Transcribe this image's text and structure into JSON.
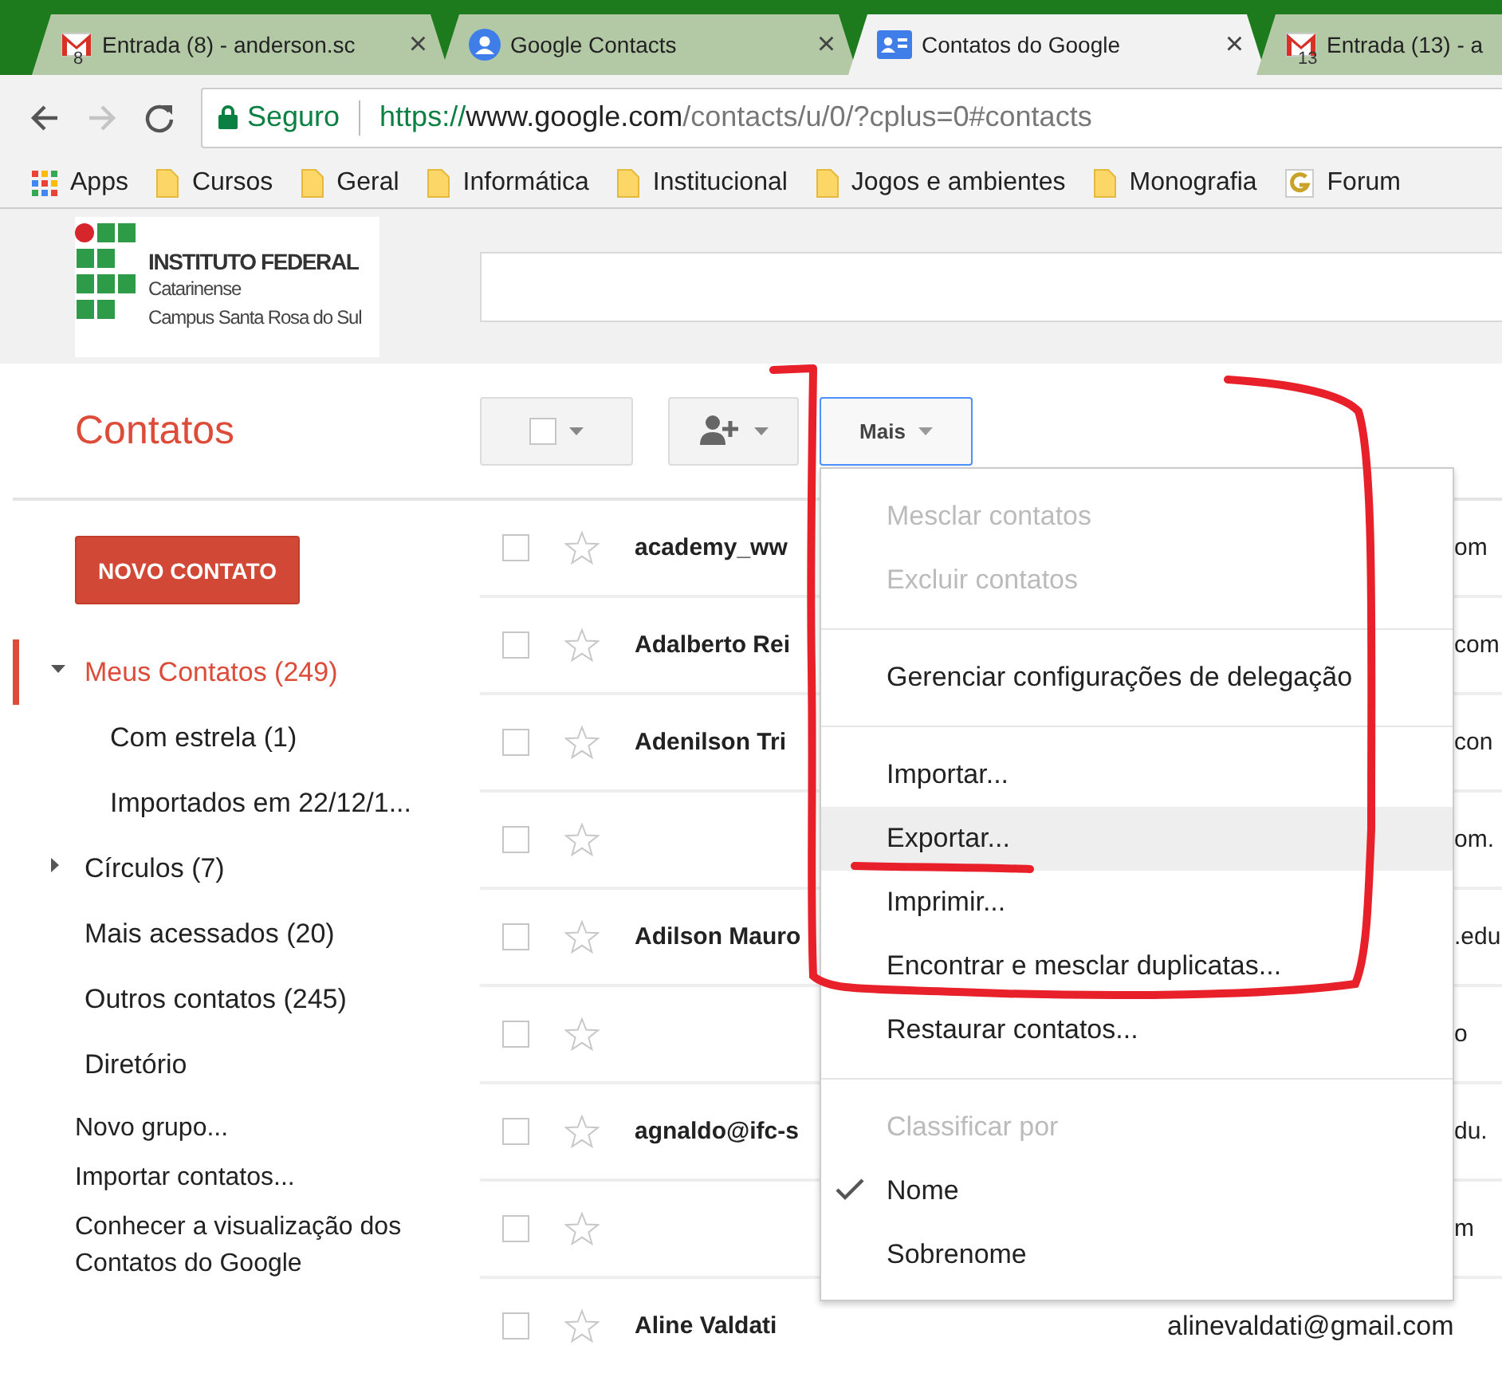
{
  "browser": {
    "tabs": [
      {
        "kind": "mail",
        "badge": "8",
        "title": "Entrada (8) - anderson.sc",
        "close": "×",
        "selected": false
      },
      {
        "kind": "person",
        "title": "Google Contacts",
        "close": "×",
        "selected": false
      },
      {
        "kind": "card",
        "title": "Contatos do Google",
        "close": "×",
        "selected": true
      },
      {
        "kind": "mail",
        "badge": "13",
        "title": "Entrada (13) - a",
        "selected": false
      }
    ],
    "nav_buttons": [
      {
        "kind": "back",
        "disabled": false
      },
      {
        "kind": "forward",
        "disabled": true
      },
      {
        "kind": "reload",
        "disabled": false
      }
    ],
    "address": {
      "security": "Seguro",
      "scheme": "https://",
      "host": "www.google.com",
      "path": "/contacts/u/0/?cplus=0#contacts"
    },
    "bookmarks": [
      {
        "kind": "apps",
        "label": "Apps"
      },
      {
        "kind": "folder",
        "label": "Cursos"
      },
      {
        "kind": "folder",
        "label": "Geral"
      },
      {
        "kind": "folder",
        "label": "Informática"
      },
      {
        "kind": "folder",
        "label": "Institucional"
      },
      {
        "kind": "folder",
        "label": "Jogos e ambientes"
      },
      {
        "kind": "folder",
        "label": "Monografia"
      },
      {
        "kind": "site",
        "label": "Forum"
      }
    ]
  },
  "logo": {
    "title": "INSTITUTO FEDERAL",
    "line_2": "Catarinense",
    "line_3": "Campus Santa Rosa do Sul"
  },
  "page_title": "Contatos",
  "toolbar": {
    "select_checked": false,
    "more_button": {
      "label": "Mais",
      "selected": true
    }
  },
  "new_contact_button": "NOVO CONTATO",
  "sidebar": {
    "items": [
      {
        "kind": "group",
        "label": "Meus Contatos (249)",
        "selected": true,
        "expanded": true,
        "children": [
          {
            "label": "Com estrela (1)",
            "selected": false
          },
          {
            "label": "Importados em 22/12/1...",
            "selected": false
          }
        ]
      },
      {
        "kind": "group",
        "label": "Círculos (7)",
        "selected": false,
        "expanded": false
      },
      {
        "kind": "item",
        "label": "Mais acessados (20)",
        "selected": false
      },
      {
        "kind": "item",
        "label": "Outros contatos (245)",
        "selected": false
      },
      {
        "kind": "item",
        "label": "Diretório",
        "selected": false
      }
    ],
    "links": [
      "Novo grupo...",
      "Importar contatos...",
      "Conhecer a visualização dos Contatos do Google"
    ]
  },
  "contacts": {
    "rows": [
      {
        "name": "academy_ww",
        "email": "om",
        "kind": "covered",
        "checked": false,
        "starred": false
      },
      {
        "name": "Adalberto Rei",
        "email": "com",
        "kind": "covered",
        "checked": false,
        "starred": false
      },
      {
        "name": "Adenilson Tri",
        "email": "con",
        "kind": "covered",
        "checked": false,
        "starred": false
      },
      {
        "email": "om.",
        "kind": "covered",
        "checked": false,
        "starred": false
      },
      {
        "name": "Adilson Mauro",
        "email": ".edu",
        "kind": "covered",
        "checked": false,
        "starred": false
      },
      {
        "email": "o",
        "kind": "covered",
        "checked": false,
        "starred": false
      },
      {
        "name": "agnaldo@ifc-s",
        "email": "du.",
        "kind": "covered",
        "checked": false,
        "starred": false
      },
      {
        "email": "m",
        "kind": "covered",
        "checked": false,
        "starred": false
      },
      {
        "name": "Aline Valdati",
        "email": "alinevaldati@gmail.com",
        "kind": "full",
        "checked": false,
        "starred": false
      }
    ]
  },
  "menu": {
    "open": true,
    "items": [
      {
        "kind": "item",
        "label": "Mesclar contatos",
        "disabled": true,
        "highlighted": false
      },
      {
        "kind": "item",
        "label": "Excluir contatos",
        "disabled": true,
        "highlighted": false
      },
      {
        "kind": "divider"
      },
      {
        "kind": "item",
        "label": "Gerenciar configurações de delegação",
        "disabled": false,
        "highlighted": false
      },
      {
        "kind": "divider"
      },
      {
        "kind": "item",
        "label": "Importar...",
        "disabled": false,
        "highlighted": false
      },
      {
        "kind": "item",
        "label": "Exportar...",
        "disabled": false,
        "highlighted": true
      },
      {
        "kind": "item",
        "label": "Imprimir...",
        "disabled": false,
        "highlighted": false
      },
      {
        "kind": "item",
        "label": "Encontrar e mesclar duplicatas...",
        "disabled": false,
        "highlighted": false
      },
      {
        "kind": "item",
        "label": "Restaurar contatos...",
        "disabled": false,
        "highlighted": false
      },
      {
        "kind": "divider"
      },
      {
        "kind": "header",
        "label": "Classificar por"
      },
      {
        "kind": "option",
        "label": "Nome",
        "checked": true
      },
      {
        "kind": "option",
        "label": "Sobrenome",
        "checked": false
      }
    ]
  },
  "annotation": {
    "loop": true,
    "underline": true
  }
}
